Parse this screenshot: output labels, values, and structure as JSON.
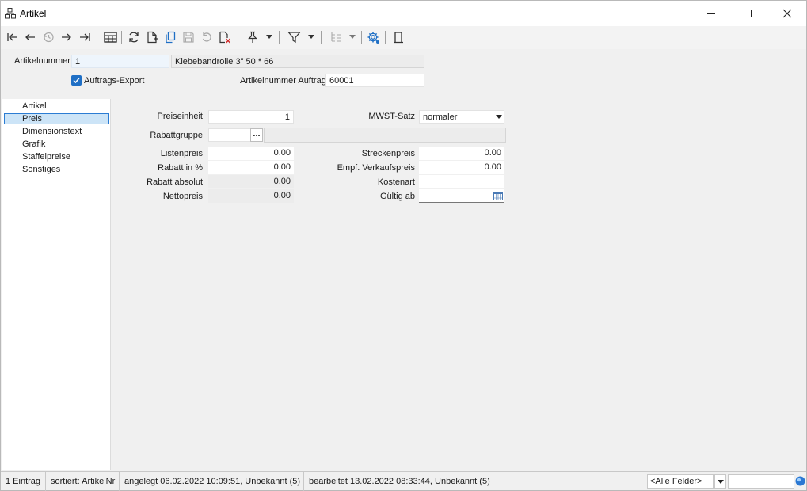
{
  "window": {
    "title": "Artikel",
    "minimize": "—",
    "maximize": "☐",
    "close": "✕"
  },
  "header": {
    "artikelnummer_label": "Artikelnummer",
    "artikelnummer_value": "1",
    "bezeichnung_value": "Klebebandrolle 3\" 50 * 66",
    "auftrags_export_label": "Auftrags-Export",
    "auftrags_export_checked": true,
    "artikelnummer_auftrag_label": "Artikelnummer Auftrag",
    "artikelnummer_auftrag_value": "60001"
  },
  "nav": {
    "items": [
      {
        "label": "Artikel"
      },
      {
        "label": "Preis"
      },
      {
        "label": "Dimensionstext"
      },
      {
        "label": "Grafik"
      },
      {
        "label": "Staffelpreise"
      },
      {
        "label": "Sonstiges"
      }
    ],
    "selected": "Preis"
  },
  "preis": {
    "preiseinheit_label": "Preiseinheit",
    "preiseinheit_value": "1",
    "rabattgruppe_label": "Rabattgruppe",
    "rabattgruppe_value": "",
    "rabattgruppe_button": "...",
    "rabattgruppe_desc": "",
    "listenpreis_label": "Listenpreis",
    "listenpreis_value": "0.00",
    "rabatt_prozent_label": "Rabatt in %",
    "rabatt_prozent_value": "0.00",
    "rabatt_absolut_label": "Rabatt absolut",
    "rabatt_absolut_value": "0.00",
    "nettopreis_label": "Nettopreis",
    "nettopreis_value": "0.00",
    "mwst_label": "MWST-Satz",
    "mwst_value": "normaler",
    "streckenpreis_label": "Streckenpreis",
    "streckenpreis_value": "0.00",
    "empf_vk_label": "Empf. Verkaufspreis",
    "empf_vk_value": "0.00",
    "kostenart_label": "Kostenart",
    "kostenart_value": "",
    "gueltig_ab_label": "Gültig ab",
    "gueltig_ab_value": ""
  },
  "status": {
    "count": "1 Eintrag",
    "sort": "sortiert: ArtikelNr",
    "created": "angelegt 06.02.2022 10:09:51, Unbekannt (5)",
    "edited": "bearbeitet 13.02.2022 08:33:44, Unbekannt (5)",
    "field_filter": "<Alle Felder>",
    "search_value": ""
  },
  "colors": {
    "accent": "#1f6fc5",
    "selection_bg": "#cce4f7",
    "selection_border": "#2b7cd3"
  },
  "icons": {
    "toolbar": [
      "first-record-icon",
      "previous-record-icon",
      "history-icon",
      "next-record-icon",
      "last-record-icon",
      "table-view-icon",
      "refresh-icon",
      "new-document-icon",
      "copy-icon",
      "save-icon",
      "undo-icon",
      "delete-document-icon",
      "pin-icon",
      "filter-icon",
      "tree-icon",
      "settings-icon",
      "bookmark-icon"
    ]
  }
}
